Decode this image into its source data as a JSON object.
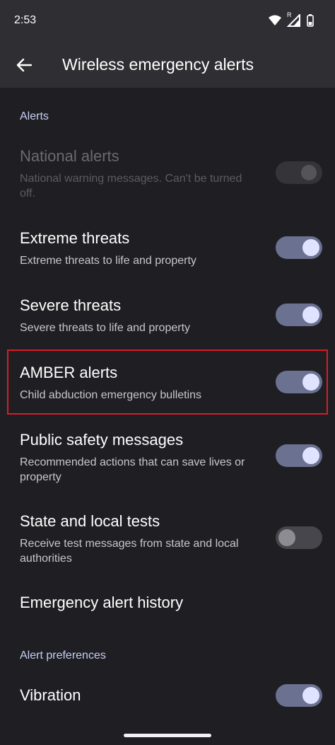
{
  "status_bar": {
    "time": "2:53",
    "roaming_mark": "R"
  },
  "app_bar": {
    "title": "Wireless emergency alerts"
  },
  "sections": {
    "alerts_header": "Alerts",
    "preferences_header": "Alert preferences"
  },
  "rows": {
    "national": {
      "title": "National alerts",
      "subtitle": "National warning messages. Can't be turned off.",
      "state": "on-disabled"
    },
    "extreme": {
      "title": "Extreme threats",
      "subtitle": "Extreme threats to life and property",
      "state": "on"
    },
    "severe": {
      "title": "Severe threats",
      "subtitle": "Severe threats to life and property",
      "state": "on"
    },
    "amber": {
      "title": "AMBER alerts",
      "subtitle": "Child abduction emergency bulletins",
      "state": "on"
    },
    "public_safety": {
      "title": "Public safety messages",
      "subtitle": "Recommended actions that can save lives or property",
      "state": "on"
    },
    "state_local": {
      "title": "State and local tests",
      "subtitle": "Receive test messages from state and local authorities",
      "state": "off"
    },
    "history": {
      "title": "Emergency alert history"
    },
    "vibration": {
      "title": "Vibration",
      "state": "on"
    }
  },
  "colors": {
    "background": "#1f1f23",
    "app_bar": "#2f2f33",
    "section_header": "#c7d0f5",
    "switch_on_track": "#6b7190",
    "switch_on_thumb": "#dfe3ff",
    "highlight": "#d81b2a"
  },
  "icons": [
    "back-arrow-icon",
    "wifi-icon",
    "signal-icon",
    "battery-icon"
  ]
}
